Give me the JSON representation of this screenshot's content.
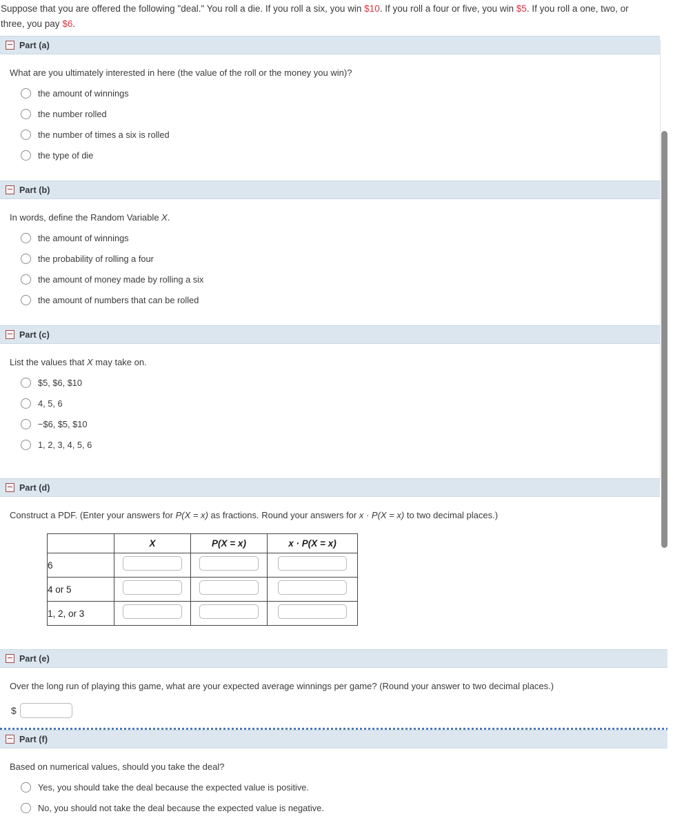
{
  "intro": {
    "text_1": "Suppose that you are offered the following \"deal.\" You roll a die. If you roll a six, you win ",
    "amount_win_six": "$10",
    "text_2": ". If you roll a four or five, you win ",
    "amount_win_four_five": "$5",
    "text_3": ". If you roll a one, two, or three, you pay ",
    "amount_pay": "$6",
    "text_4": "."
  },
  "parts": {
    "a": {
      "label": "Part (a)",
      "question": "What are you ultimately interested in here (the value of the roll or the money you win)?",
      "options": [
        "the amount of winnings",
        "the number rolled",
        "the number of times a six is rolled",
        "the type of die"
      ]
    },
    "b": {
      "label": "Part (b)",
      "question_pre": "In words, define the Random Variable ",
      "question_var": "X",
      "question_post": ".",
      "options": [
        "the amount of winnings",
        "the probability of rolling a four",
        "the amount of money made by rolling a six",
        "the amount of numbers that can be rolled"
      ]
    },
    "c": {
      "label": "Part (c)",
      "question_pre": "List the values that ",
      "question_var": "X",
      "question_post": " may take on.",
      "options": [
        "$5, $6, $10",
        "4, 5, 6",
        "−$6, $5, $10",
        "1, 2, 3, 4, 5, 6"
      ]
    },
    "d": {
      "label": "Part (d)",
      "question_1": "Construct a PDF. (Enter your answers for ",
      "question_pxx": "P(X = x)",
      "question_2": " as fractions. Round your answers for ",
      "question_xpxx": "x · P(X = x)",
      "question_3": " to two decimal places.)",
      "table": {
        "headers": [
          "",
          "X",
          "P(X = x)",
          "x · P(X = x)"
        ],
        "rows": [
          {
            "label": "6",
            "x": "",
            "p": "",
            "xp": ""
          },
          {
            "label": "4 or 5",
            "x": "",
            "p": "",
            "xp": ""
          },
          {
            "label": "1, 2, or 3",
            "x": "",
            "p": "",
            "xp": ""
          }
        ]
      }
    },
    "e": {
      "label": "Part (e)",
      "question": "Over the long run of playing this game, what are your expected average winnings per game? (Round your answer to two decimal places.)",
      "currency_symbol": "$",
      "answer_value": ""
    },
    "f": {
      "label": "Part (f)",
      "question": "Based on numerical values, should you take the deal?",
      "options": [
        "Yes, you should take the deal because the expected value is positive.",
        "No, you should not take the deal because the expected value is negative."
      ]
    }
  },
  "icons": {
    "collapse": "minus-box-icon"
  },
  "colors": {
    "accent_money": "#d9333f",
    "header_bar": "#dce6ef",
    "separator_dots": "#4a78b5",
    "toggle_border": "#a0484c"
  }
}
